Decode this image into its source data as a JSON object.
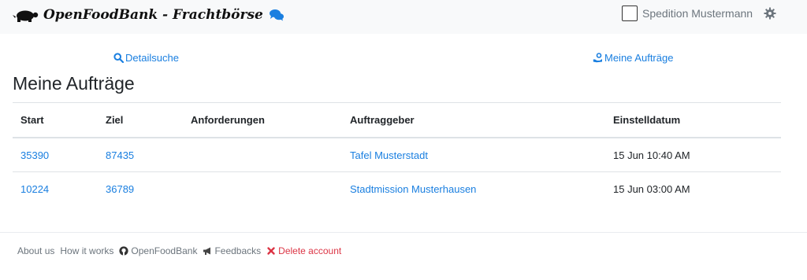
{
  "navbar": {
    "brand": "OpenFoodBank - Frachtbörse",
    "logo_icon": "turtle-icon",
    "chat_icon": "comments-icon",
    "user_name": "Spedition Mustermann",
    "settings_icon": "gear-icon"
  },
  "links": {
    "detail_search": "Detailsuche",
    "my_orders": "Meine Aufträge"
  },
  "page": {
    "title": "Meine Aufträge"
  },
  "table": {
    "headers": [
      "Start",
      "Ziel",
      "Anforderungen",
      "Auftraggeber",
      "Einstelldatum"
    ],
    "rows": [
      {
        "start": "35390",
        "ziel": "87435",
        "anforderungen": "",
        "auftraggeber": "Tafel Musterstadt",
        "datum": "15 Jun 10:40 AM"
      },
      {
        "start": "10224",
        "ziel": "36789",
        "anforderungen": "",
        "auftraggeber": "Stadtmission Musterhausen",
        "datum": "15 Jun 03:00 AM"
      }
    ]
  },
  "footer": {
    "about": "About us",
    "how": "How it works",
    "github": "OpenFoodBank",
    "feedbacks": "Feedbacks",
    "delete": "Delete account"
  },
  "colors": {
    "link": "#1a7fe0",
    "danger": "#dc3545",
    "navbar_bg": "#f8f9fa"
  }
}
